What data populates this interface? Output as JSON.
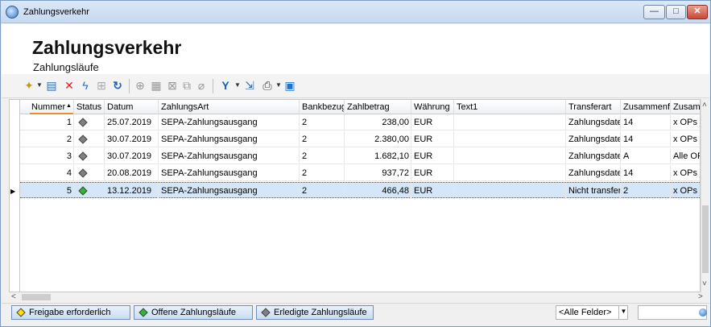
{
  "window": {
    "title": "Zahlungsverkehr",
    "buttons": {
      "minimize": "—",
      "maximize": "□",
      "close": "✕"
    }
  },
  "header": {
    "title": "Zahlungsverkehr",
    "subtitle": "Zahlungsläufe"
  },
  "toolbar": {
    "icons": [
      "wand-icon",
      "chevron-down-icon",
      "document-icon",
      "delete-icon",
      "lightning-icon",
      "grid-icon",
      "refresh-icon",
      "add-record-icon",
      "edit-record-icon",
      "delete-record-icon",
      "copy-record-icon",
      "eraser-icon",
      "filter-icon",
      "chevron-down-icon",
      "export-icon",
      "print-icon",
      "chevron-down-icon",
      "save-icon"
    ]
  },
  "table": {
    "columns": [
      "Nummer",
      "Status",
      "Datum",
      "ZahlungsArt",
      "Bankbezug",
      "Zahlbetrag",
      "Währung",
      "Text1",
      "Transferart",
      "Zusammenfa",
      "Zusamr"
    ],
    "rows": [
      {
        "nummer": "1",
        "status_color": "#808080",
        "datum": "25.07.2019",
        "art": "SEPA-Zahlungsausgang",
        "bank": "2",
        "betrag": "238,00",
        "waehrung": "EUR",
        "text1": "",
        "transfer": "Zahlungsdate",
        "zus1": "14",
        "zus2": "x OPs je"
      },
      {
        "nummer": "2",
        "status_color": "#808080",
        "datum": "30.07.2019",
        "art": "SEPA-Zahlungsausgang",
        "bank": "2",
        "betrag": "2.380,00",
        "waehrung": "EUR",
        "text1": "",
        "transfer": "Zahlungsdate",
        "zus1": "14",
        "zus2": "x OPs je"
      },
      {
        "nummer": "3",
        "status_color": "#808080",
        "datum": "30.07.2019",
        "art": "SEPA-Zahlungsausgang",
        "bank": "2",
        "betrag": "1.682,10",
        "waehrung": "EUR",
        "text1": "",
        "transfer": "Zahlungsdate",
        "zus1": "A",
        "zus2": "Alle OP"
      },
      {
        "nummer": "4",
        "status_color": "#808080",
        "datum": "20.08.2019",
        "art": "SEPA-Zahlungsausgang",
        "bank": "2",
        "betrag": "937,72",
        "waehrung": "EUR",
        "text1": "",
        "transfer": "Zahlungsdate",
        "zus1": "14",
        "zus2": "x OPs je"
      },
      {
        "nummer": "5",
        "status_color": "#2db82d",
        "datum": "13.12.2019",
        "art": "SEPA-Zahlungsausgang",
        "bank": "2",
        "betrag": "466,48",
        "waehrung": "EUR",
        "text1": "",
        "transfer": "Nicht transfer",
        "zus1": "2",
        "zus2": "x OPs je"
      }
    ],
    "selected_row": 5
  },
  "legend": {
    "freigabe": {
      "label": "Freigabe erforderlich",
      "color": "#ffe000"
    },
    "offene": {
      "label": "Offene Zahlungsläufe",
      "color": "#2db82d"
    },
    "erledigte": {
      "label": "Erledigte Zahlungsläufe",
      "color": "#808080"
    }
  },
  "filter": {
    "field_value": "<Alle Felder>"
  }
}
